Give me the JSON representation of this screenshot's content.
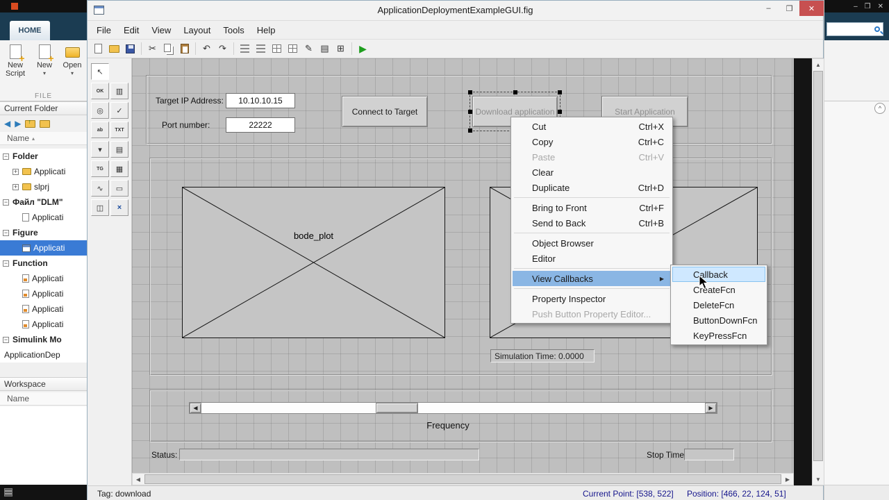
{
  "colors": {
    "close_red": "#c75050",
    "menu_highlight": "#8ab6e4",
    "submenu_highlight": "#cfe8ff",
    "tree_selection": "#3a7bd5",
    "status_text_blue": "#15158c",
    "run_green": "#1e9e1e"
  },
  "icons": {
    "minus": "−",
    "plus": "+",
    "dd": "▾",
    "back": "◀",
    "forward": "▶",
    "sort_up": "▴",
    "cut": "✂",
    "undo": "↶",
    "redo": "↷",
    "run": "▶",
    "editor_pen": "✎",
    "inspector": "▤",
    "browser": "⊞",
    "pointer": "↖",
    "palette_push": "OK",
    "palette_slider": "▥",
    "palette_radio": "◎",
    "palette_check": "✓",
    "palette_edit": "ab",
    "palette_text": "TXT",
    "palette_popup": "▾",
    "palette_list": "▤",
    "palette_toggle": "TG",
    "palette_table": "▦",
    "palette_axes": "∿",
    "palette_panel": "▭",
    "palette_group": "◫",
    "palette_activex": "×",
    "submenu_arrow": "▶",
    "scroll_up": "▲",
    "scroll_down": "▼",
    "scroll_left": "◀",
    "scroll_right": "▶",
    "collapse_chevron": "^",
    "win_min": "–",
    "win_max": "❒",
    "win_close": "✕"
  },
  "matlab": {
    "home_tab": "HOME",
    "new_script": "New Script",
    "new": "New",
    "open": "Open",
    "file_section": "FILE",
    "current_folder_title": "Current Folder",
    "name_header": "Name",
    "workspace_title": "Workspace",
    "workspace_name_header": "Name",
    "tree": [
      "Folder",
      "Applicati",
      "slprj",
      "Файл \"DLM\"",
      "Applicati",
      "Figure",
      "Applicati",
      "Function",
      "Applicati",
      "Applicati",
      "Applicati",
      "Applicati",
      "Simulink Mo",
      "ApplicationDep"
    ]
  },
  "guide": {
    "title": "ApplicationDeploymentExampleGUI.fig",
    "menus": [
      "File",
      "Edit",
      "View",
      "Layout",
      "Tools",
      "Help"
    ],
    "gui": {
      "ip_label": "Target IP Address:",
      "ip_value": "10.10.10.15",
      "port_label": "Port number:",
      "port_value": "22222",
      "connect_btn": "Connect to Target",
      "download_btn": "Download application",
      "start_btn": "Start Application",
      "axes1_label": "bode_plot",
      "sim_time": "Simulation Time: 0.0000",
      "freq_label": "Frequency",
      "status_label": "Status:",
      "stop_time_label": "Stop Time:"
    },
    "context_menu": [
      {
        "label": "Cut",
        "shortcut": "Ctrl+X"
      },
      {
        "label": "Copy",
        "shortcut": "Ctrl+C"
      },
      {
        "label": "Paste",
        "shortcut": "Ctrl+V",
        "disabled": true
      },
      {
        "label": "Clear"
      },
      {
        "label": "Duplicate",
        "shortcut": "Ctrl+D"
      },
      {
        "label": "Bring to Front",
        "shortcut": "Ctrl+F"
      },
      {
        "label": "Send to Back",
        "shortcut": "Ctrl+B"
      },
      {
        "label": "Object Browser"
      },
      {
        "label": "Editor"
      },
      {
        "label": "View Callbacks",
        "highlighted": true
      },
      {
        "label": "Property Inspector"
      },
      {
        "label": "Push Button Property Editor...",
        "disabled": true
      }
    ],
    "submenu": [
      {
        "label": "Callback",
        "highlighted": true
      },
      {
        "label": "CreateFcn"
      },
      {
        "label": "DeleteFcn"
      },
      {
        "label": "ButtonDownFcn"
      },
      {
        "label": "KeyPressFcn"
      }
    ],
    "statusbar": {
      "tag": "Tag: download",
      "current_point": "Current Point: [538, 522]",
      "position": "Position: [466, 22, 124, 51]"
    }
  }
}
